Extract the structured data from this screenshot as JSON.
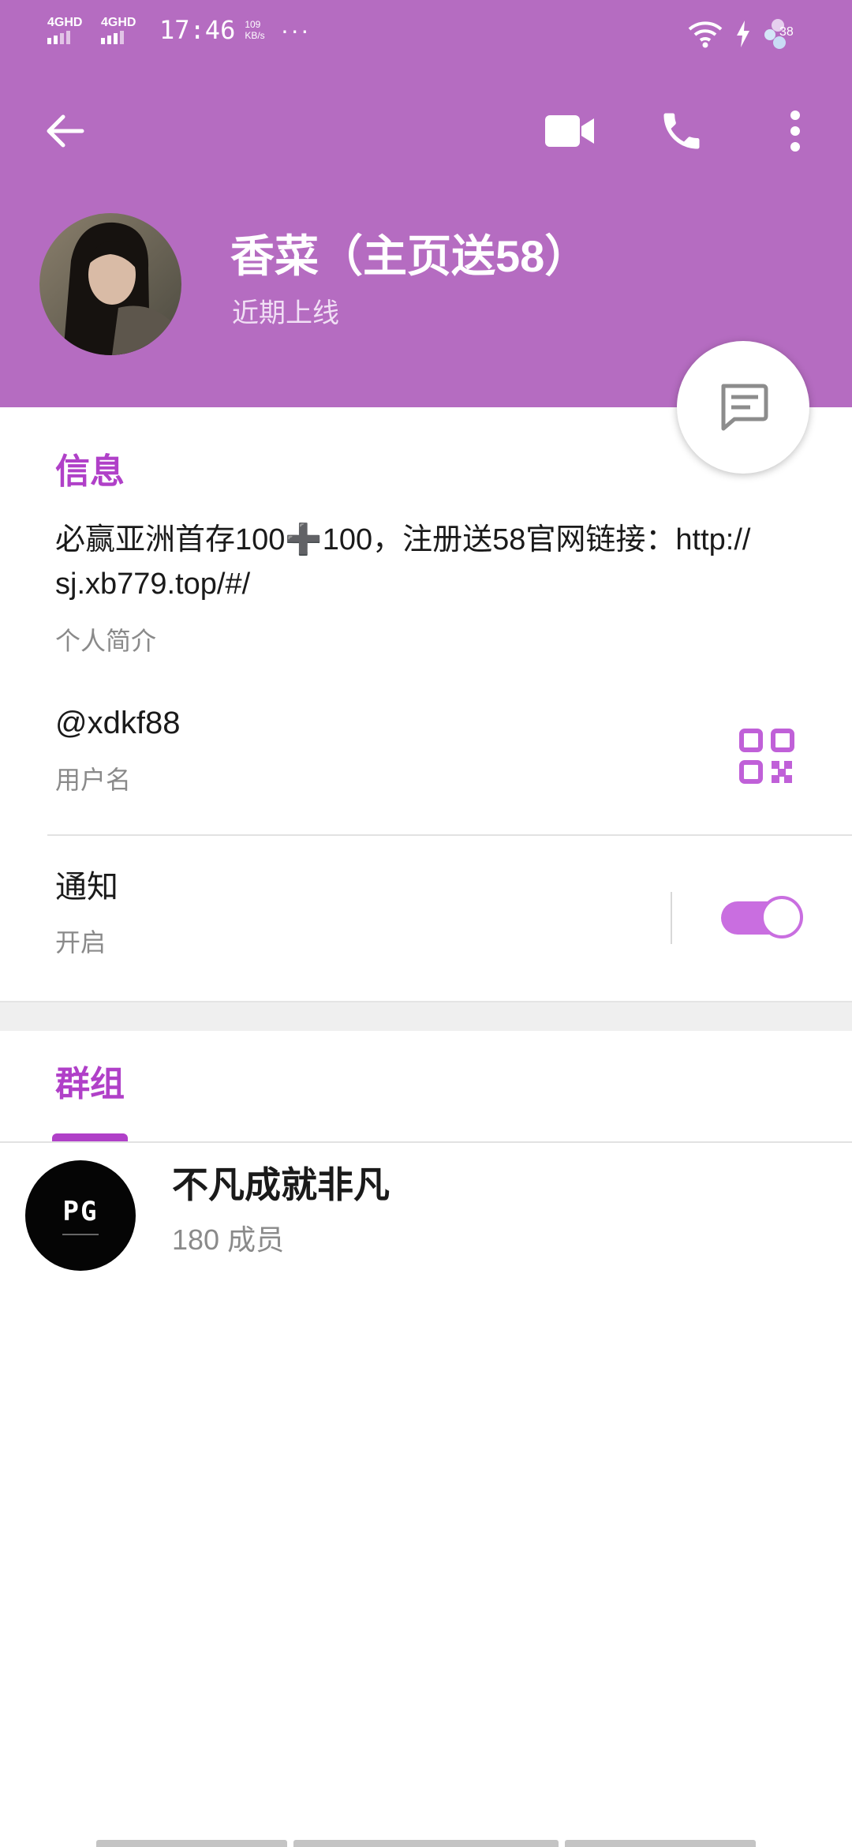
{
  "status_bar": {
    "net1": "4GHD",
    "net2": "4GHD",
    "time": "17:46",
    "speed_value": "109",
    "speed_unit": "KB/s",
    "more": "···",
    "battery": "38"
  },
  "profile": {
    "name": "香菜（主页送58）",
    "status": "近期上线"
  },
  "info": {
    "section_title": "信息",
    "bio": "必赢亚洲首存100➕100，注册送58官网链接：http://sj.xb779.top/#/",
    "bio_caption": "个人简介",
    "username": "@xdkf88",
    "username_caption": "用户名",
    "notifications_label": "通知",
    "notifications_caption": "开启",
    "notifications_enabled": true
  },
  "groups": {
    "tab_label": "群组",
    "items": [
      {
        "avatar_text": "PG",
        "name": "不凡成就非凡",
        "members": "180 成员"
      }
    ]
  },
  "colors": {
    "header": "#b56cc1",
    "accent": "#b040c8",
    "toggle": "#c96ee0"
  }
}
